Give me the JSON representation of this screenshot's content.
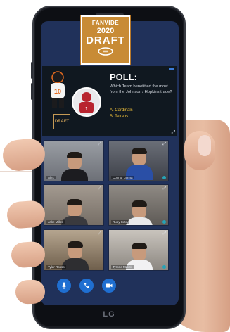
{
  "logo": {
    "brand": "FANVIDE",
    "year": "2020",
    "event": "DRAFT"
  },
  "poll": {
    "title": "POLL:",
    "question": "Which Team benefitted the most from the Johnson / Hopkins trade?",
    "options": [
      "A.  Cardinals",
      "B.  Texans"
    ],
    "badge_label": "DRAFT"
  },
  "participants": [
    {
      "name": "Alex",
      "icon": "video-tile"
    },
    {
      "name": "Connor Lenna",
      "icon": "video-tile"
    },
    {
      "name": "Jake Miller",
      "icon": "video-tile"
    },
    {
      "name": "Ruby Soto",
      "icon": "video-tile"
    },
    {
      "name": "Tyler Rosso",
      "icon": "video-tile"
    },
    {
      "name": "Tyrone Malick",
      "icon": "video-tile"
    }
  ],
  "controls": [
    {
      "name": "microphone",
      "icon": "mic-icon"
    },
    {
      "name": "phone",
      "icon": "phone-icon"
    },
    {
      "name": "camera",
      "icon": "video-camera-icon"
    }
  ],
  "device": {
    "brand": "LG"
  },
  "colors": {
    "accent": "#1f6fd1",
    "logo": "#c88b35",
    "screen": "#20315a",
    "poll_option": "#f2c23a"
  }
}
